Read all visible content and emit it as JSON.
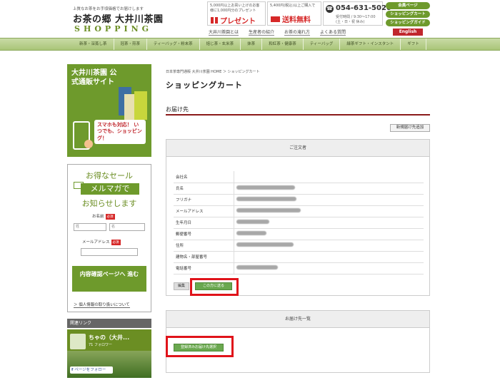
{
  "header": {
    "tagline": "上質なお茶をお手頃価格でお届けします",
    "logo_main": "お茶の郷 大井川茶園",
    "logo_sub": "SHOPPING",
    "promo1_small": "5,000円以上お買い上げのお客様に1,000円分のプレゼント",
    "promo1_big": "プレゼント",
    "promo2_small": "5,400円(税込)以上ご購入で",
    "promo2_big": "送料無料",
    "phone": "054-631-5020",
    "phone_hours": "受付時間 / 9:30～17:00 (土・日・祝 休み)",
    "btn_member": "会員ページ",
    "btn_cart": "ショッピングカート",
    "btn_guide": "ショッピングガイド",
    "btn_english": "English",
    "links": [
      "大井川茶園とは",
      "生産者の紹介",
      "お茶の淹れ方",
      "よくある質問"
    ]
  },
  "nav": [
    "新茶・深蒸し茶",
    "冠茶・煎茶",
    "ティーバッグ・粉末茶",
    "焙じ茶・玄米茶",
    "抹茶",
    "和紅茶・健康茶",
    "ティーバッグ",
    "緑茶ギフト・インスタント",
    "ギフト"
  ],
  "sidebar": {
    "banner_title": "大井川茶園 公式通販サイト",
    "banner_mobile": "スマホも対応！ いつでも、ショッピング！",
    "mail_t1": "お得なセール",
    "mail_t2": "メルマガで",
    "mail_t3": "お知らせします",
    "name_label": "お名前",
    "required": "必須",
    "last_placeholder": "姓",
    "first_placeholder": "名",
    "email_label": "メールアドレス",
    "submit": "内容確認ページへ 進む",
    "privacy": "＞ 個人情報の取り扱いについて",
    "related_head": "関連リンク",
    "related_title": "ちゃの（大井...",
    "related_sub": "71 フォロワー",
    "related_follow": "ページをフォロー"
  },
  "main": {
    "breadcrumb": "日本茶専門通販 大井川茶園 HOME ＞ ショッピングカート",
    "page_title": "ショッピングカート",
    "section_title": "お届け先",
    "add_new_button": "新規届け先追加",
    "orderer_panel_title": "ご注文者",
    "fields": [
      {
        "label": "会社名",
        "blur": 0
      },
      {
        "label": "氏名",
        "blur": 82
      },
      {
        "label": "フリガナ",
        "blur": 84
      },
      {
        "label": "メールアドレス",
        "blur": 90
      },
      {
        "label": "生年月日",
        "blur": 46
      },
      {
        "label": "郵便番号",
        "blur": 42
      },
      {
        "label": "住所",
        "blur": 80
      },
      {
        "label": "建物名・部屋番号",
        "blur": 0
      },
      {
        "label": "電話番号",
        "blur": 58
      }
    ],
    "edit_button": "編集",
    "ship_here_button": "この方に送る",
    "delivery_panel_title": "お届け先一覧",
    "ship_registered_button": "登録済みお届け先選択"
  },
  "colors": {
    "brand_green": "#6e9a2c",
    "accent_red": "#d62828",
    "highlight": "#e0131a"
  }
}
